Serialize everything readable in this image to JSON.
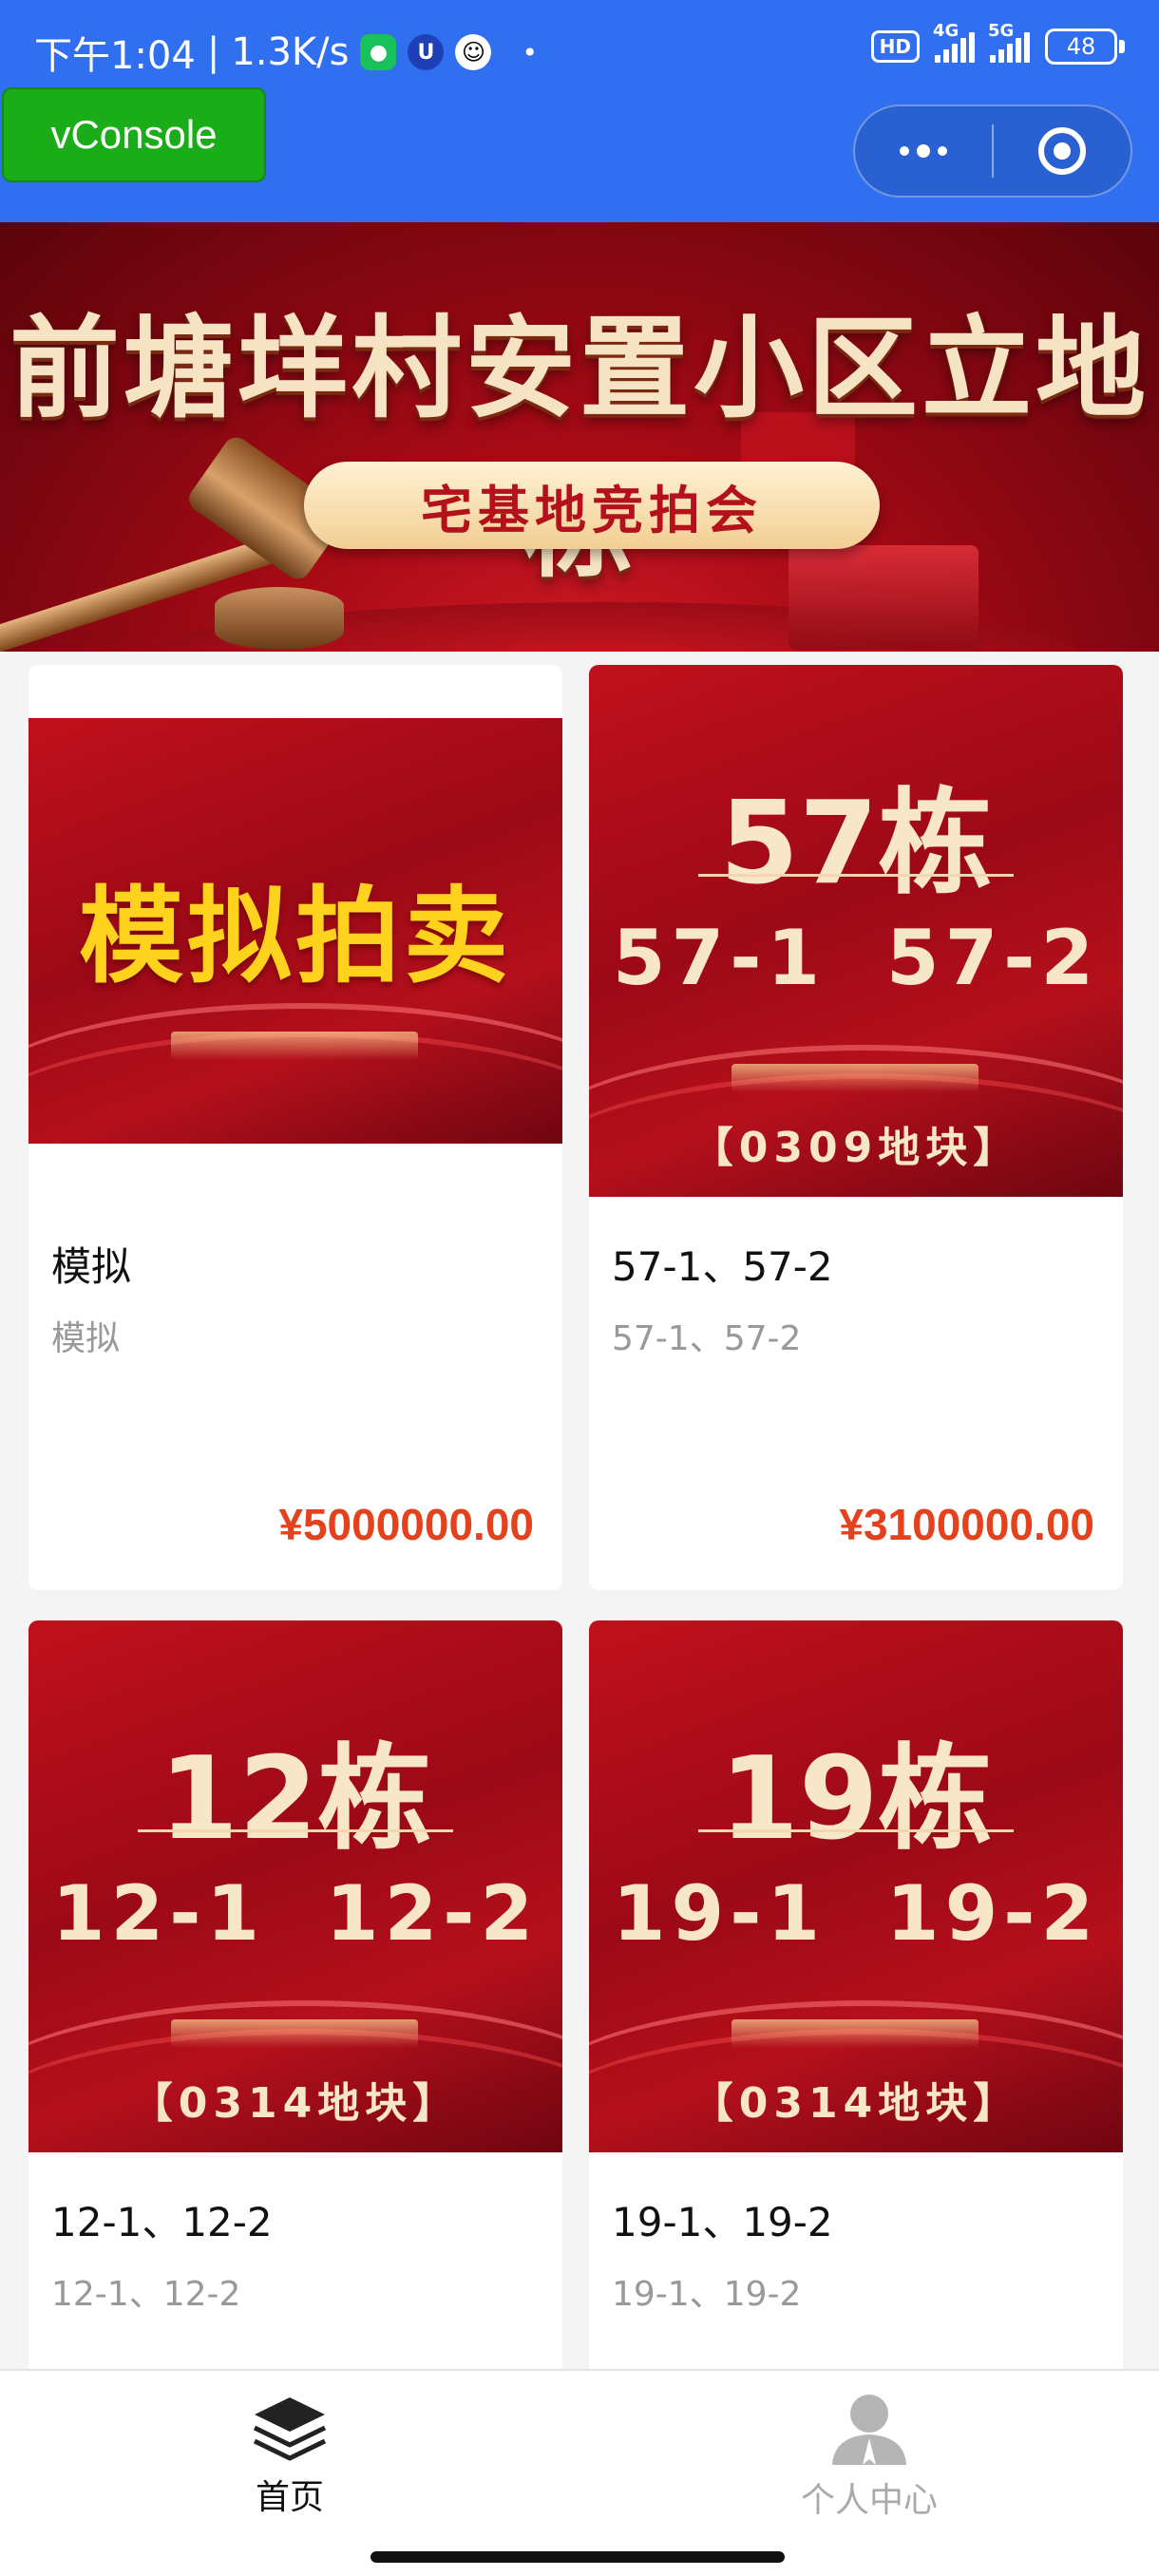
{
  "status_bar": {
    "time": "下午1:04",
    "net_speed": "1.3K/s",
    "hd": "HD",
    "signal_1": "4G",
    "signal_2": "5G",
    "battery": "48"
  },
  "debug_button": "vConsole",
  "capsule": {
    "more_icon": "more-dots-icon",
    "close_icon": "target-icon"
  },
  "banner": {
    "title": "前塘垟村安置小区立地栋",
    "subtitle": "宅基地竞拍会"
  },
  "cards": [
    {
      "thumb_text": "模拟拍卖",
      "title": "模拟",
      "subtitle": "模拟",
      "price": "¥5000000.00"
    },
    {
      "thumb_building": "57栋",
      "thumb_units": "57-1 57-2",
      "thumb_plot": "【0309地块】",
      "title": "57-1、57-2",
      "subtitle": "57-1、57-2",
      "price": "¥3100000.00"
    },
    {
      "thumb_building": "12栋",
      "thumb_units": "12-1 12-2",
      "thumb_plot": "【0314地块】",
      "title": "12-1、12-2",
      "subtitle": "12-1、12-2"
    },
    {
      "thumb_building": "19栋",
      "thumb_units": "19-1 19-2",
      "thumb_plot": "【0314地块】",
      "title": "19-1、19-2",
      "subtitle": "19-1、19-2"
    }
  ],
  "tabbar": {
    "home": "首页",
    "profile": "个人中心"
  },
  "colors": {
    "header": "#2f6ff0",
    "price": "#e3421d",
    "vconsole": "#1aad19"
  }
}
